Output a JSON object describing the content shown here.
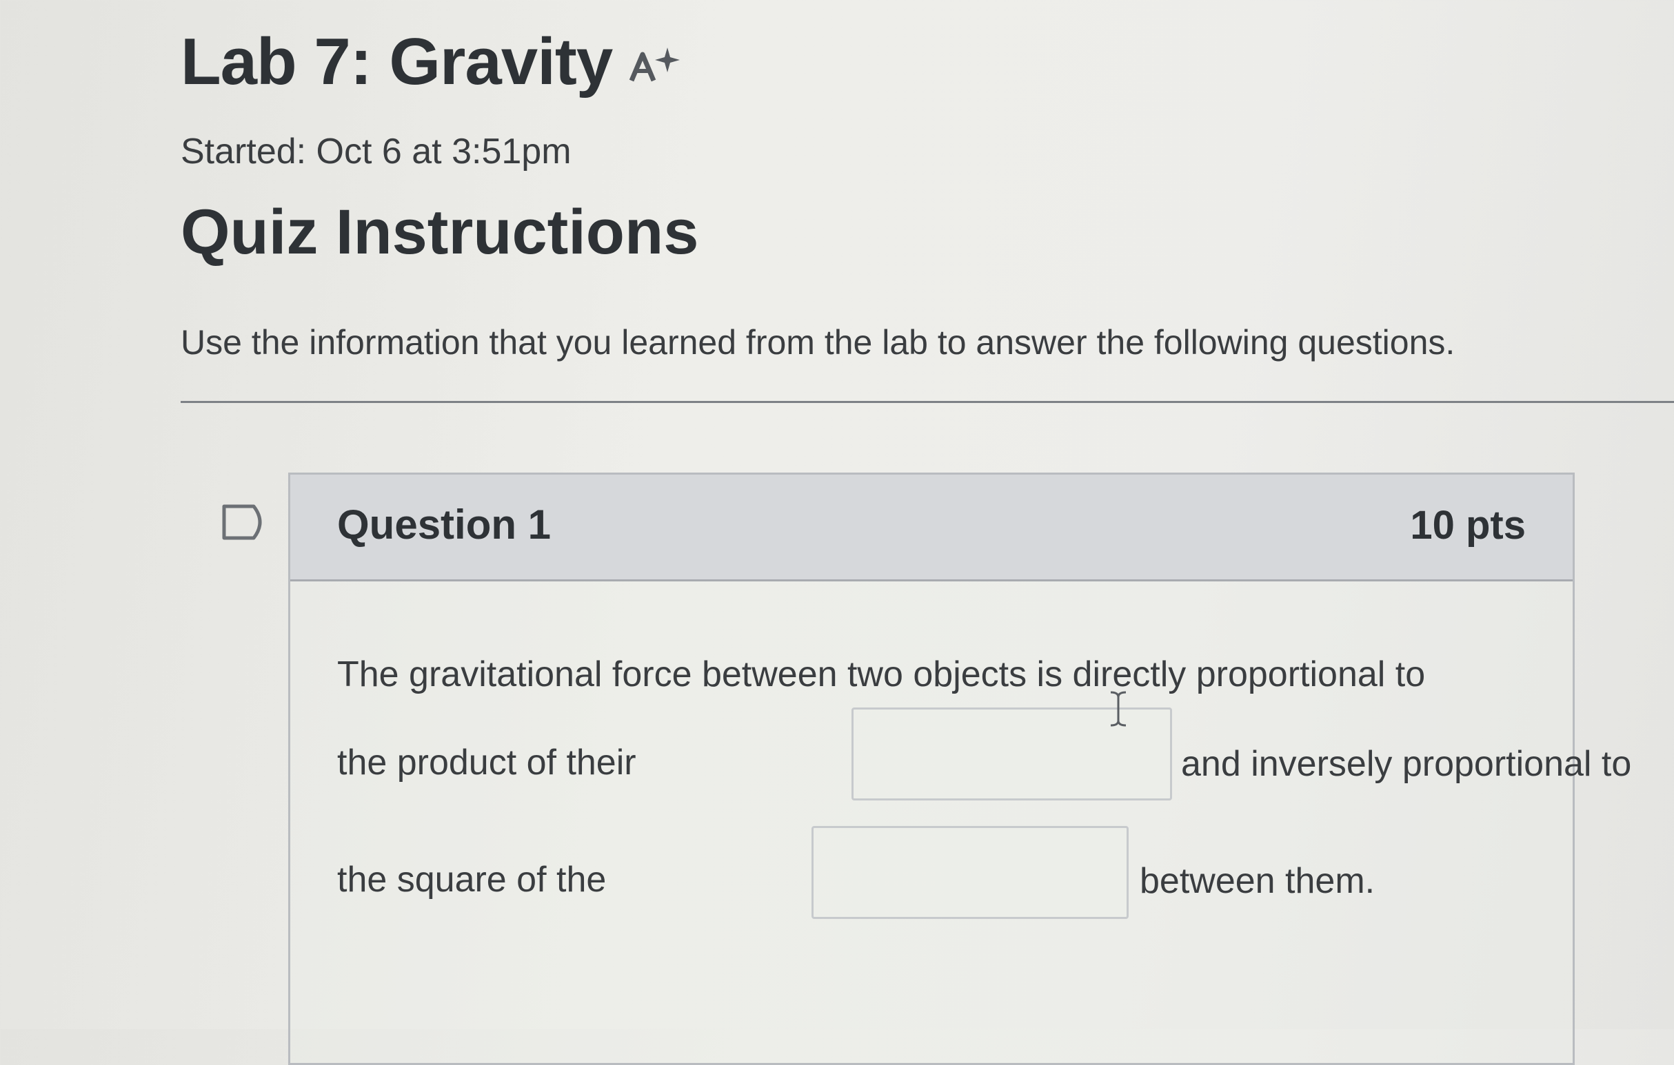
{
  "header": {
    "title": "Lab 7: Gravity",
    "started_text": "Started: Oct 6 at 3:51pm",
    "icons": [
      "ai-sparkle-icon"
    ]
  },
  "instructions": {
    "heading": "Quiz Instructions",
    "text": "Use the information that you learned from the lab to answer the following questions."
  },
  "question": {
    "name": "Question 1",
    "points": "10 pts",
    "text_line1": "The gravitational force between two objects is directly proportional to",
    "text_line2_before": "the product of their",
    "text_line2_after": "and inversely proportional to",
    "text_line3_before": "the square of the",
    "text_line3_after": "between them.",
    "blank1_value": "",
    "blank2_value": "",
    "icons": [
      "flag-icon",
      "text-cursor-icon"
    ]
  }
}
